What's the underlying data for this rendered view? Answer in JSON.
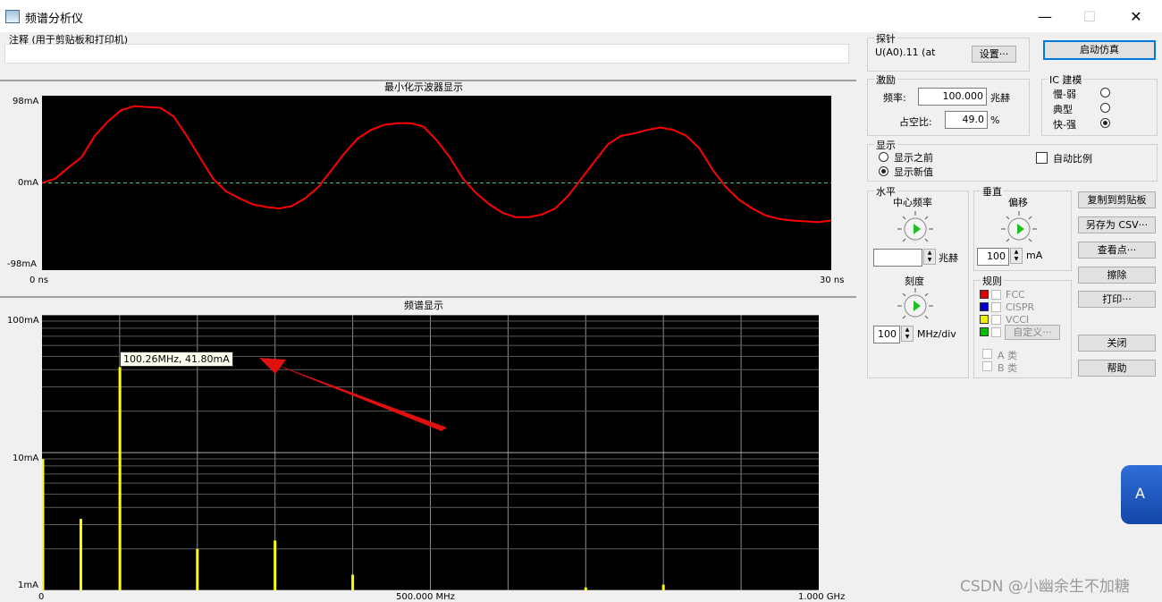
{
  "window": {
    "title": "频谱分析仪",
    "minimize": "—",
    "maximize": "☐",
    "close": "✕"
  },
  "note": {
    "label": "注释 (用于剪贴板和打印机)",
    "value": ""
  },
  "scope": {
    "title": "最小化示波器显示",
    "y_top": "98mA",
    "y_mid": "0mA",
    "y_bot": "-98mA",
    "x_left": "0 ns",
    "x_right": "30 ns"
  },
  "spectrum": {
    "title": "频谱显示",
    "y_100": "100mA",
    "y_10": "10mA",
    "y_1": "1mA",
    "x_0": "0",
    "x_mid": "500.000 MHz",
    "x_end": "1.000 GHz",
    "tooltip": "100.26MHz, 41.80mA"
  },
  "probe": {
    "label": "探针",
    "value": "U(A0).11 (at",
    "settings_btn": "设置···"
  },
  "start_sim_btn": "启动仿真",
  "stimulus": {
    "label": "激励",
    "freq_label": "频率:",
    "freq_value": "100.000",
    "freq_unit": "兆赫",
    "duty_label": "占空比:",
    "duty_value": "49.0",
    "duty_unit": "%"
  },
  "ic_model": {
    "label": "IC 建模",
    "options": [
      "慢-弱",
      "典型",
      "快-强"
    ],
    "selected": 2
  },
  "display": {
    "label": "显示",
    "options": [
      "显示之前",
      "显示新值"
    ],
    "selected": 1,
    "auto_scale": "自动比例"
  },
  "horizontal": {
    "label": "水平",
    "center_label": "中心频率",
    "center_value": "",
    "center_unit": "兆赫",
    "scale_label": "刻度",
    "scale_value": "100",
    "scale_unit": "MHz/div"
  },
  "vertical": {
    "label": "垂直",
    "offset_label": "偏移",
    "offset_value": "100",
    "offset_unit": "mA"
  },
  "rules": {
    "label": "规则",
    "items": [
      "FCC",
      "CISPR",
      "VCCI"
    ],
    "colors": [
      "#e00000",
      "#0000d0",
      "#f0f000",
      "#00c000"
    ],
    "custom_btn": "自定义···",
    "class_a": "A 类",
    "class_b": "B 类"
  },
  "actions": {
    "copy": "复制到剪贴板",
    "save_csv": "另存为 CSV···",
    "view_points": "查看点···",
    "clear": "擦除",
    "print": "打印···",
    "close": "关闭",
    "help": "帮助"
  },
  "floating_badge": "A",
  "watermark": "CSDN @小幽余生不加糖",
  "colors": {
    "scope_trace": "#ff0000",
    "zero_line": "#40c080",
    "spectrum_bar": "#ffff00",
    "plot_bg": "#000000",
    "accent": "#0078d7"
  },
  "chart_data": [
    {
      "type": "line",
      "title": "最小化示波器显示",
      "xlabel": "",
      "ylabel": "",
      "xlim": [
        0,
        30
      ],
      "ylim": [
        -98,
        98
      ],
      "x_unit": "ns",
      "y_unit": "mA",
      "grid": false,
      "series": [
        {
          "x": [
            0,
            0.5,
            1,
            1.5,
            2,
            2.5,
            3,
            3.5,
            4,
            4.5,
            5,
            5.5,
            6,
            6.5,
            7,
            7.5,
            8,
            8.5,
            9,
            9.5,
            10,
            10.5,
            11,
            11.5,
            12,
            12.5,
            13,
            13.5,
            14,
            14.5,
            15,
            15.5,
            16,
            16.5,
            17,
            17.5,
            18,
            18.5,
            19,
            19.5,
            20,
            20.5,
            21,
            21.5,
            22,
            22.5,
            23,
            23.5,
            24,
            24.5,
            25,
            25.5,
            26,
            26.5,
            27,
            27.5,
            28,
            28.5,
            29,
            29.5,
            30
          ],
          "y": [
            0,
            5,
            18,
            30,
            55,
            72,
            85,
            90,
            89,
            88,
            78,
            55,
            30,
            5,
            -10,
            -18,
            -25,
            -28,
            -30,
            -27,
            -18,
            -5,
            15,
            35,
            52,
            62,
            68,
            70,
            70,
            66,
            50,
            30,
            5,
            -12,
            -25,
            -35,
            -40,
            -40,
            -37,
            -30,
            -15,
            5,
            25,
            45,
            55,
            58,
            62,
            65,
            62,
            55,
            40,
            15,
            -5,
            -20,
            -30,
            -38,
            -42,
            -44,
            -45,
            -46,
            -44
          ]
        }
      ]
    },
    {
      "type": "bar",
      "title": "频谱显示",
      "xlabel": "",
      "ylabel": "",
      "xlim": [
        0,
        1000
      ],
      "ylim": [
        1,
        100
      ],
      "x_unit": "MHz",
      "y_unit": "mA",
      "y_scale": "log",
      "grid": true,
      "series": [
        {
          "x": [
            0,
            50,
            100.26,
            200,
            300,
            400,
            700,
            800
          ],
          "y": [
            9,
            3.3,
            41.8,
            2.0,
            2.3,
            1.3,
            1.05,
            1.1
          ]
        }
      ]
    }
  ]
}
